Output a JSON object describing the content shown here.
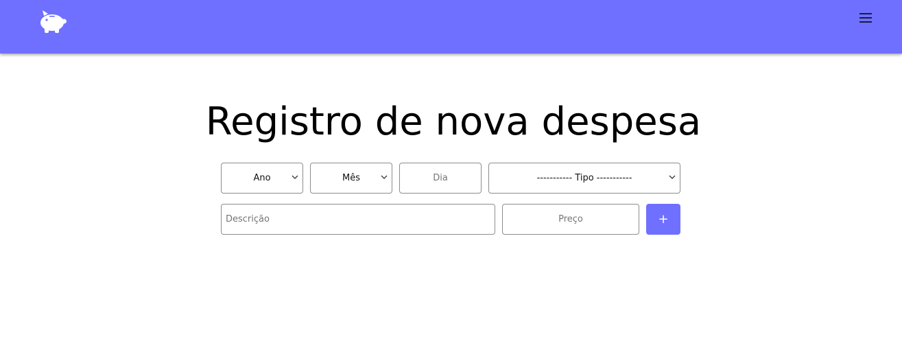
{
  "header": {
    "logo_icon": "piggy-bank-icon",
    "menu_icon": "hamburger-menu-icon",
    "background_color": "#6f70ff"
  },
  "main": {
    "title": "Registro de nova despesa"
  },
  "form": {
    "ano_select": {
      "selected": "Ano"
    },
    "mes_select": {
      "selected": "Mês"
    },
    "dia_input": {
      "placeholder": "Dia"
    },
    "tipo_select": {
      "selected": "----------- Tipo -----------"
    },
    "descricao_input": {
      "placeholder": "Descrição"
    },
    "preco_input": {
      "placeholder": "Preço"
    },
    "add_button": {
      "label": "+"
    }
  }
}
